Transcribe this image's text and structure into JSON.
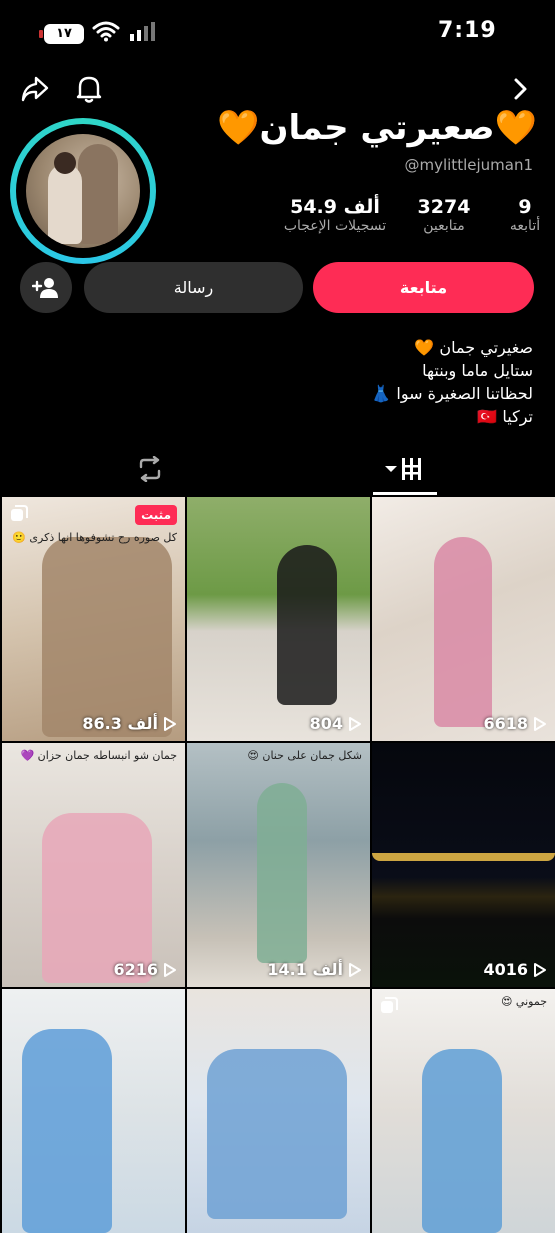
{
  "status_bar": {
    "time": "7:19",
    "battery": "١٧"
  },
  "profile": {
    "display_name": "🧡صعيرتي جمان🧡",
    "handle": "@mylittlejuman1",
    "stats": [
      {
        "value": "9",
        "label": "أتابعه"
      },
      {
        "value": "3274",
        "label": "متابعين"
      },
      {
        "value": "54.9 ألف",
        "label": "تسجيلات الإعجاب"
      }
    ],
    "follow_label": "متابعة",
    "message_label": "رسالة",
    "bio": [
      "صغيرتي جمان 🧡",
      "ستايل ماما وبنتها",
      "لحظاتنا الصغيرة سوا 👗",
      "تركيا 🇹🇷"
    ]
  },
  "icons": {
    "back": "chevron-right-icon",
    "share": "share-icon",
    "notifications": "bell-icon",
    "add_friend": "add-person-icon",
    "repost": "repost-icon",
    "grid": "grid-icon",
    "play": "play-icon",
    "multi_photo": "multi-photo-icon"
  },
  "colors": {
    "accent": "#fe2c55",
    "ring": "#2fd6c6"
  },
  "videos": [
    {
      "views": "6618",
      "pinned": "",
      "caption": ""
    },
    {
      "views": "804",
      "pinned": "",
      "caption": ""
    },
    {
      "views": "86.3 ألف",
      "pinned": "مثبت",
      "caption": "كل صوره رح تشوفوها انها ذكرى 🙂"
    },
    {
      "views": "4016",
      "pinned": "",
      "caption": ""
    },
    {
      "views": "14.1 ألف",
      "pinned": "",
      "caption": "شكل جمان على حنان 😍"
    },
    {
      "views": "6216",
      "pinned": "",
      "caption": "جمان شو انبساطه جمان حزان 💜"
    },
    {
      "views": "",
      "pinned": "",
      "caption": "جموني 😍"
    },
    {
      "views": "",
      "pinned": "",
      "caption": ""
    },
    {
      "views": "",
      "pinned": "",
      "caption": ""
    }
  ]
}
